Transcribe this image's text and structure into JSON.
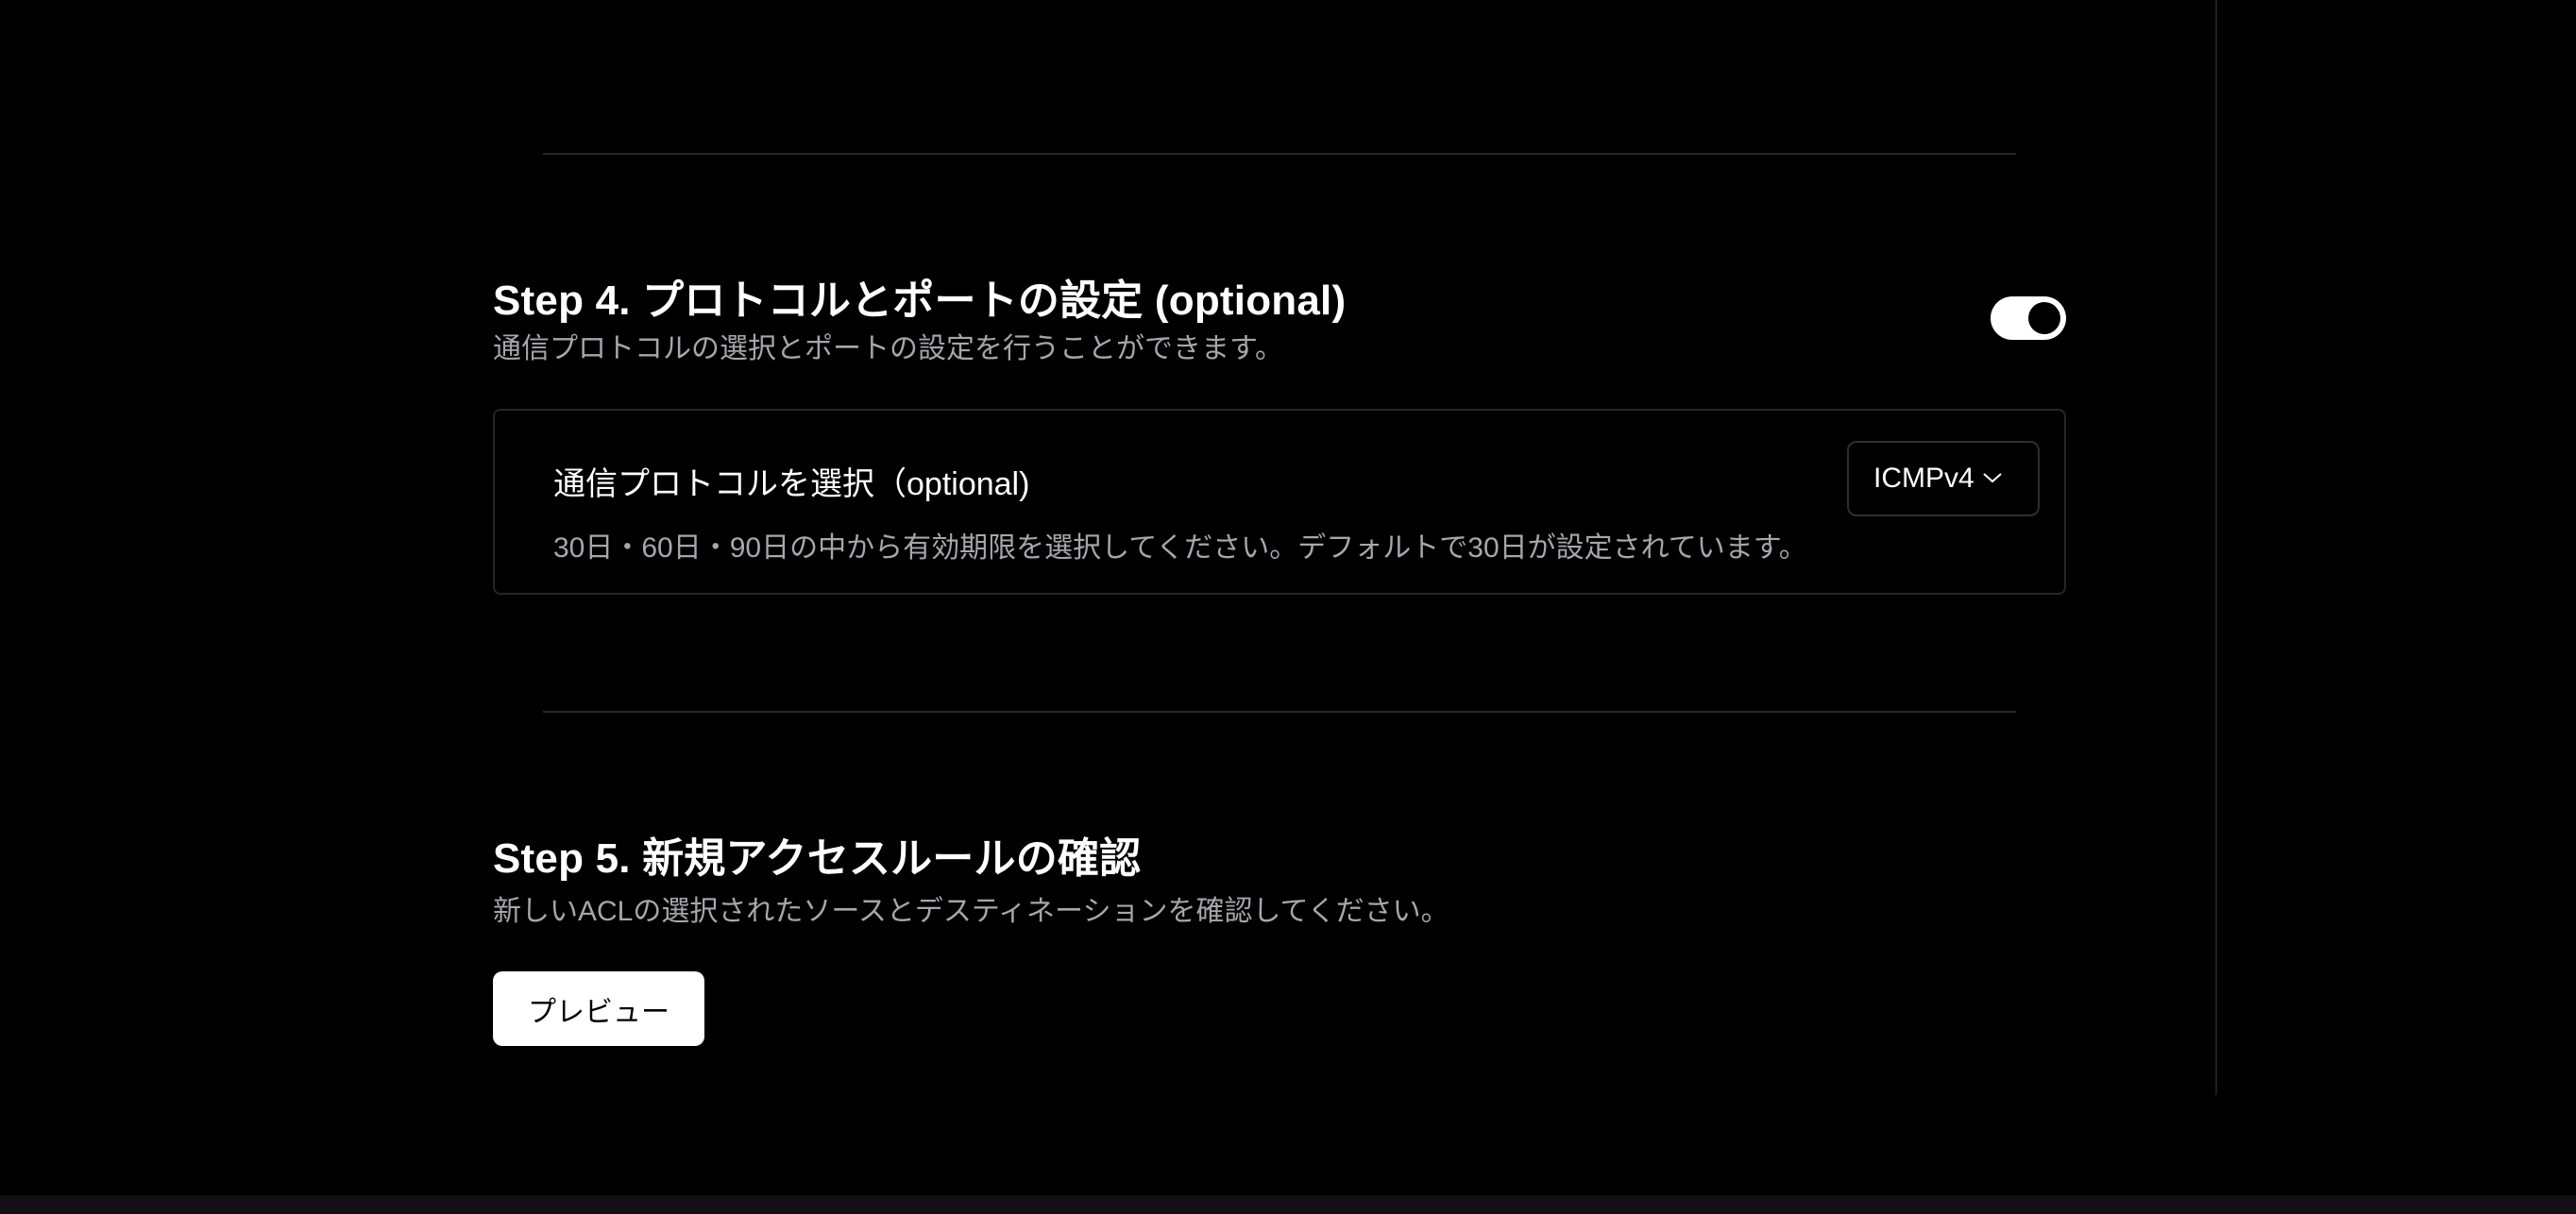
{
  "step4": {
    "title": "Step 4. プロトコルとポートの設定 (optional)",
    "description": "通信プロトコルの選択とポートの設定を行うことができます。",
    "toggle_on": true,
    "protocol_card": {
      "title": "通信プロトコルを選択（optional)",
      "description": "30日・60日・90日の中から有効期限を選択してください。デフォルトで30日が設定されています。",
      "selected_protocol": "ICMPv4"
    }
  },
  "step5": {
    "title": "Step 5. 新規アクセスルールの確認",
    "description": "新しいACLの選択されたソースとデスティネーションを確認してください。",
    "preview_label": "プレビュー"
  },
  "icons": {
    "select_chevron": "chevron-down-icon"
  },
  "colors": {
    "background": "#000000",
    "text_primary": "#ffffff",
    "text_secondary": "#a6a6ab",
    "border": "#262629"
  }
}
